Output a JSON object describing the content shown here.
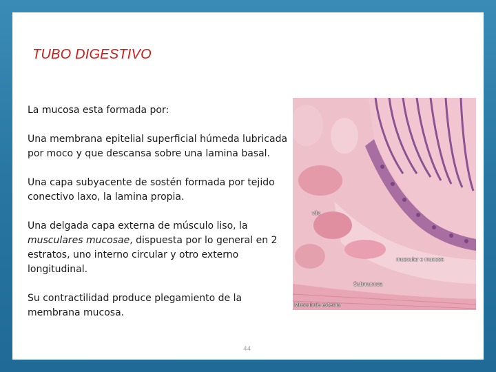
{
  "slide": {
    "title": "TUBO DIGESTIVO",
    "intro_subject": "La mucosa",
    "intro_rest": " esta formada por:",
    "paragraph1": "Una membrana epitelial superficial húmeda lubricada por moco y que descansa sobre una lamina basal.",
    "paragraph2": "Una capa subyacente de sostén formada por tejido conectivo laxo, la lamina propia.",
    "paragraph3_start": "Una delgada capa externa de músculo liso, la ",
    "paragraph3_term": "musculares mucosae",
    "paragraph3_end": ", dispuesta por lo general en 2 estratos, uno interno circular y otro externo longitudinal.",
    "paragraph4": "Su contractilidad produce plegamiento de la membrana mucosa.",
    "page_number": "44"
  },
  "image": {
    "labels": {
      "villus": "vilo",
      "muscularis_mucosae": "muscular e mucosa",
      "submucosa": "Submucosa",
      "muscularis_externa": "Muscularis externa"
    }
  },
  "colors": {
    "title": "#d11a1a",
    "background": "#2a77a3"
  }
}
